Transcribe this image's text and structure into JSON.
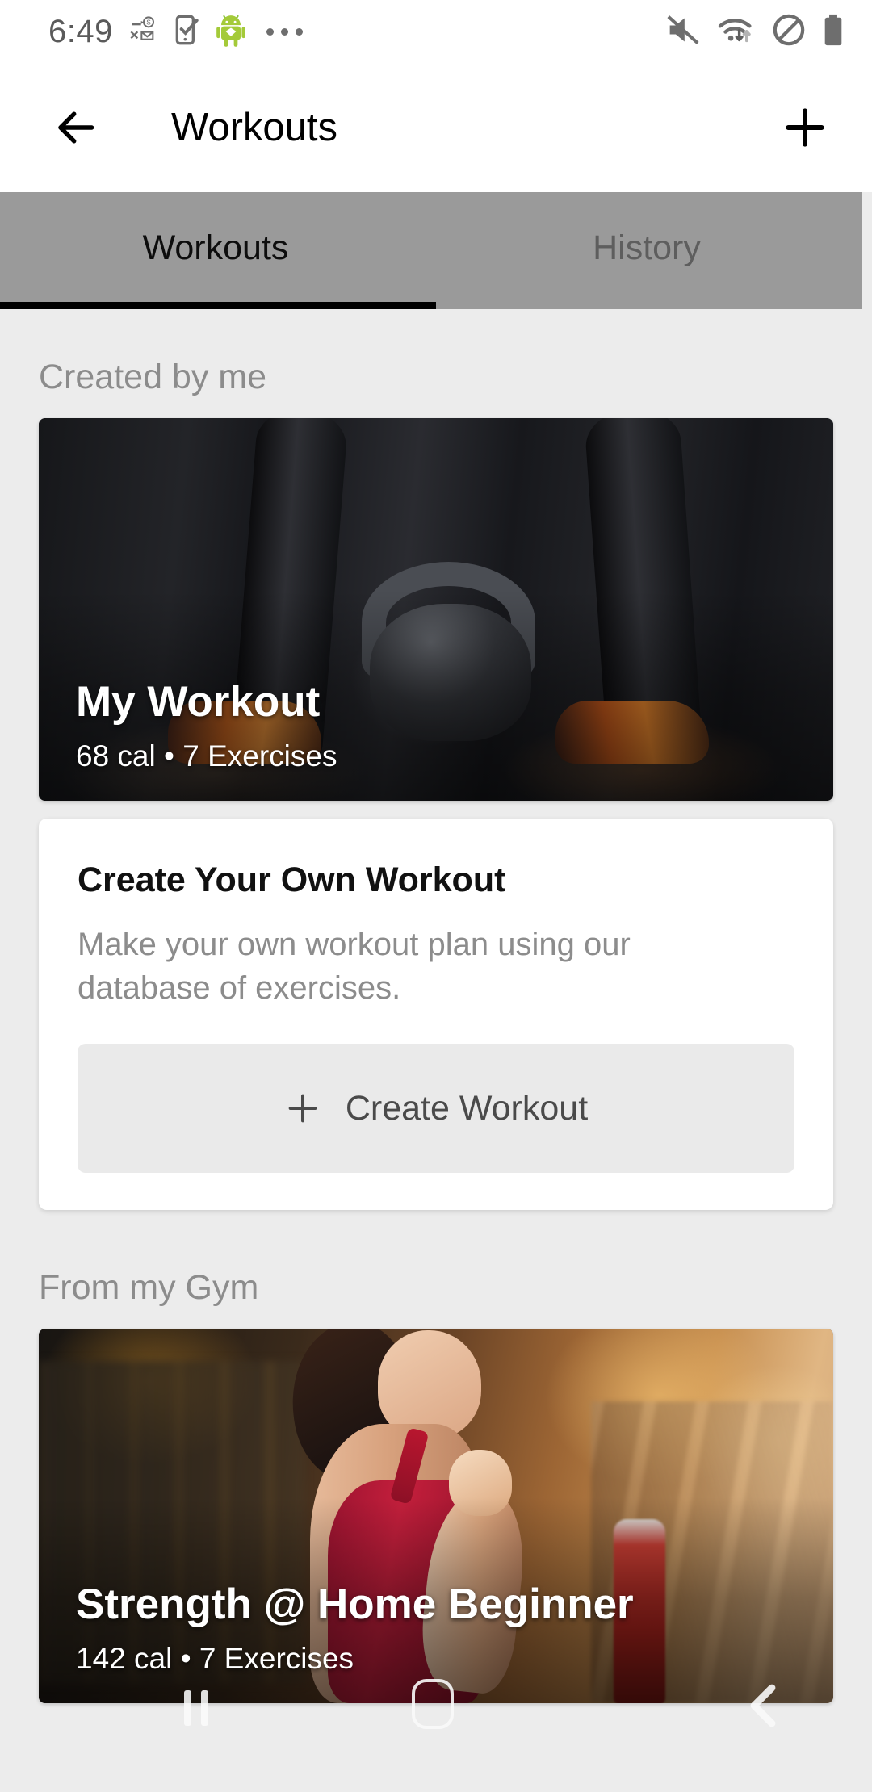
{
  "status_bar": {
    "time": "6:49",
    "notification_icons": [
      "key-dollar-icon",
      "phone-check-icon",
      "android-robot-icon",
      "overflow-dots-icon"
    ],
    "system_icons": [
      "volume-muted-icon",
      "wifi-transfer-icon",
      "do-not-disturb-icon",
      "battery-full-icon"
    ]
  },
  "header": {
    "title": "Workouts",
    "back_icon": "arrow-left-icon",
    "add_icon": "plus-icon"
  },
  "tabs": [
    {
      "label": "Workouts",
      "active": true
    },
    {
      "label": "History",
      "active": false
    }
  ],
  "sections": [
    {
      "title": "Created by me",
      "workout": {
        "name": "My Workout",
        "calories": "68 cal",
        "separator": "•",
        "exercises": "7 Exercises",
        "meta": "68 cal • 7 Exercises",
        "image": "kettlebell-legs-photo"
      },
      "create_card": {
        "title": "Create Your Own Workout",
        "description": "Make your own workout plan using our database of exercises.",
        "button_label": "Create Workout",
        "button_icon": "plus-icon"
      }
    },
    {
      "title": "From my Gym",
      "workout": {
        "name": "Strength @ Home Beginner",
        "calories": "142 cal",
        "separator": "•",
        "exercises": "7 Exercises",
        "meta": "142 cal • 7 Exercises",
        "image": "gym-woman-treadmill-photo"
      }
    }
  ],
  "nav_bar": {
    "recents_icon": "recents-bars-icon",
    "home_icon": "home-square-icon",
    "back_icon": "back-chevron-icon"
  },
  "colors": {
    "app_bar_bg": "#ffffff",
    "tab_bar_bg": "#9a9a9a",
    "tab_indicator": "#000000",
    "page_bg": "#ececec",
    "card_bg": "#ffffff",
    "section_title": "#8c8c8c",
    "button_bg": "#eaeaea",
    "button_text": "#4a4a4a"
  }
}
